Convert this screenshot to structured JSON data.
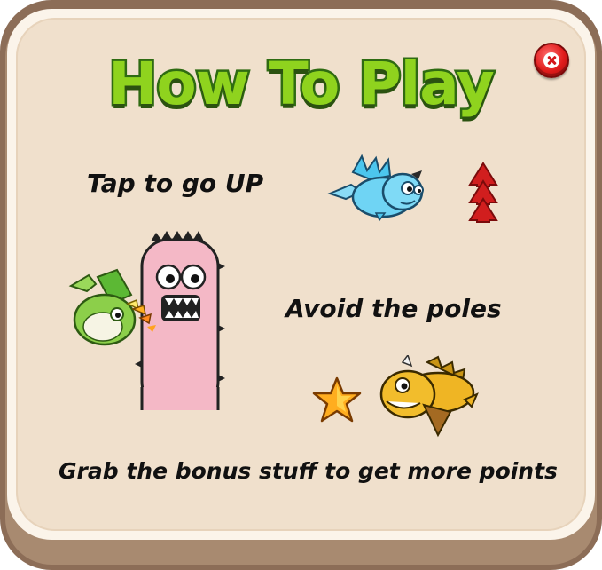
{
  "window": {
    "title": "How To Play"
  },
  "close_button": {
    "icon": "close-icon",
    "color": "#e01b1b"
  },
  "instructions": {
    "tap": "Tap to go UP",
    "avoid": "Avoid the poles",
    "grab": "Grab the bonus stuff to get more points"
  },
  "colors": {
    "title_fill": "#8fd31e",
    "title_stroke": "#2f6b12",
    "panel_bg": "#f0e0cc",
    "frame": "#8c6d57"
  },
  "illustrations": {
    "blue_dragon": "blue-dragon-icon",
    "up_arrows": "up-arrows-icon",
    "pole_monster": "pink-pole-monster-icon",
    "green_dragon": "green-dragon-icon",
    "bonus_star": "star-icon",
    "yellow_dragon": "yellow-dragon-icon"
  }
}
